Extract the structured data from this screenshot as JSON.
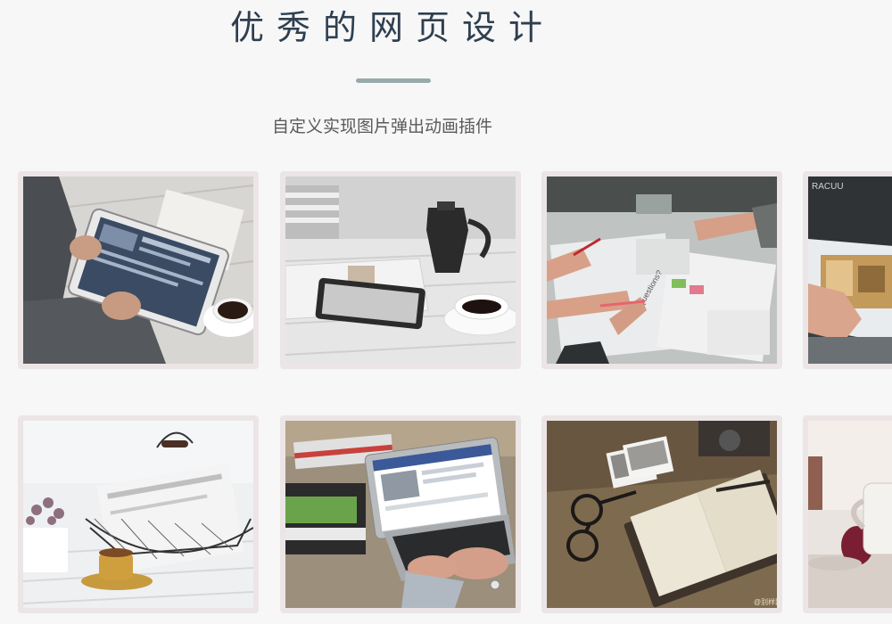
{
  "header": {
    "title": "优秀的网页设计",
    "subtitle": "自定义实现图片弹出动画插件"
  },
  "gallery": {
    "items": [
      {
        "name": "tablet-on-desk-photo"
      },
      {
        "name": "coffee-and-tablet-photo"
      },
      {
        "name": "team-brainstorm-photo"
      },
      {
        "name": "magazine-reading-photo"
      },
      {
        "name": "wire-basket-tea-photo"
      },
      {
        "name": "laptop-typing-photo"
      },
      {
        "name": "notebook-and-glasses-photo"
      },
      {
        "name": "coffee-mug-photo"
      }
    ],
    "watermark": "@别样网"
  },
  "colors": {
    "background": "#f7f7f8",
    "title": "#2f3f4f",
    "divider": "#98aaa9",
    "card_frame": "#ece5e5"
  }
}
